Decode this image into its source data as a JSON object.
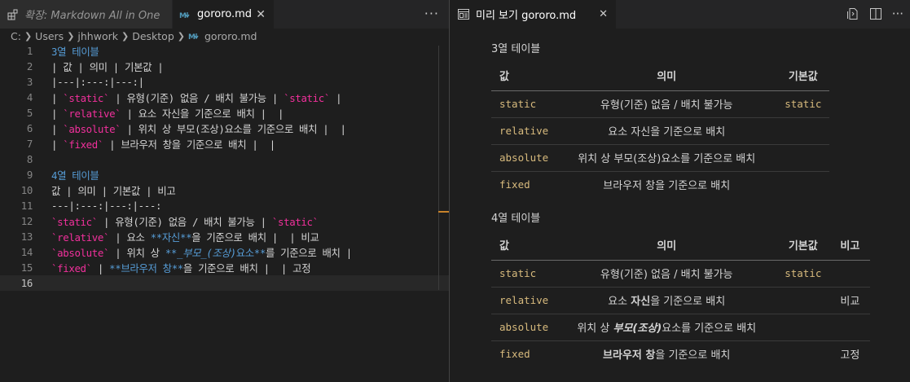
{
  "editor": {
    "tabs": [
      {
        "label": "확장: Markdown All in One",
        "icon": "extensions-icon",
        "active": false
      },
      {
        "label": "gororo.md",
        "icon": "markdown-icon",
        "active": true
      }
    ],
    "more_label": "···",
    "breadcrumb": [
      "C:",
      "Users",
      "jhhwork",
      "Desktop",
      "gororo.md"
    ],
    "line_numbers": [
      "1",
      "2",
      "3",
      "4",
      "5",
      "6",
      "7",
      "8",
      "9",
      "10",
      "11",
      "12",
      "13",
      "14",
      "15",
      "16"
    ],
    "lines": {
      "l1": "3열 테이블",
      "l2": "| 값 | 의미 | 기본값 |",
      "l3": "|---|:---:|---:|",
      "l4": {
        "p1": "| ",
        "c1": "`static`",
        "p2": " | 유형(기준) 없음 / 배치 불가능 | ",
        "c2": "`static`",
        "p3": " |"
      },
      "l5": {
        "p1": "| ",
        "c1": "`relative`",
        "p2": " | 요소 자신을 기준으로 배치 |  |"
      },
      "l6": {
        "p1": "| ",
        "c1": "`absolute`",
        "p2": " | 위치 상 부모(조상)요소를 기준으로 배치 |  |"
      },
      "l7": {
        "p1": "| ",
        "c1": "`fixed`",
        "p2": " | 브라우저 창을 기준으로 배치 |  |"
      },
      "l9": "4열 테이블",
      "l10": "값 | 의미 | 기본값 | 비고",
      "l11": "---|:---:|---:|---:",
      "l12": {
        "c1": "`static`",
        "p1": " | 유형(기준) 없음 / 배치 불가능 | ",
        "c2": "`static`"
      },
      "l13": {
        "c1": "`relative`",
        "p1": " | 요소 ",
        "b1": "**자신**",
        "p2": "을 기준으로 배치 |  | 비교"
      },
      "l14": {
        "c1": "`absolute`",
        "p1": " | 위치 상 ",
        "b1": "**",
        "i1": "_부모_(조상)",
        "b2": "요소**",
        "p2": "를 기준으로 배치 |"
      },
      "l15": {
        "c1": "`fixed`",
        "p1": " | ",
        "b1": "**브라우저 창**",
        "p2": "을 기준으로 배치 |  | 고정"
      }
    }
  },
  "preview": {
    "tab_label": "미리 보기 gororo.md",
    "tab_icon": "preview-icon",
    "actions": [
      "open-source-icon",
      "split-editor-icon",
      "more-actions-icon"
    ],
    "table3": {
      "title": "3열 테이블",
      "headers": [
        "값",
        "의미",
        "기본값"
      ],
      "rows": [
        {
          "key": "static",
          "desc": "유형(기준) 없음 / 배치 불가능",
          "default": "static"
        },
        {
          "key": "relative",
          "desc": "요소 자신을 기준으로 배치",
          "default": ""
        },
        {
          "key": "absolute",
          "desc": "위치 상 부모(조상)요소를 기준으로 배치",
          "default": ""
        },
        {
          "key": "fixed",
          "desc": "브라우저 창을 기준으로 배치",
          "default": ""
        }
      ]
    },
    "table4": {
      "title": "4열 테이블",
      "headers": [
        "값",
        "의미",
        "기본값",
        "비고"
      ],
      "rows": [
        {
          "key": "static",
          "desc_pre": "유형(기준) 없음 / 배치 불가능",
          "desc_bold": "",
          "desc_post": "",
          "default": "static",
          "note": ""
        },
        {
          "key": "relative",
          "desc_pre": "요소 ",
          "desc_bold": "자신",
          "desc_post": "을 기준으로 배치",
          "default": "",
          "note": "비교"
        },
        {
          "key": "absolute",
          "desc_pre": "위치 상 ",
          "desc_bold": "부모(조상)",
          "desc_post": "요소를 기준으로 배치",
          "default": "",
          "note": ""
        },
        {
          "key": "fixed",
          "desc_pre": "",
          "desc_bold": "브라우저 창",
          "desc_post": "을 기준으로 배치",
          "default": "",
          "note": "고정"
        }
      ]
    }
  },
  "colors": {
    "editor_bg": "#1e1e1e",
    "heading": "#569cd6",
    "inline_code_backtick": "#f1309c",
    "preview_code": "#d7ba7d",
    "accent_marker": "#c7822a"
  }
}
